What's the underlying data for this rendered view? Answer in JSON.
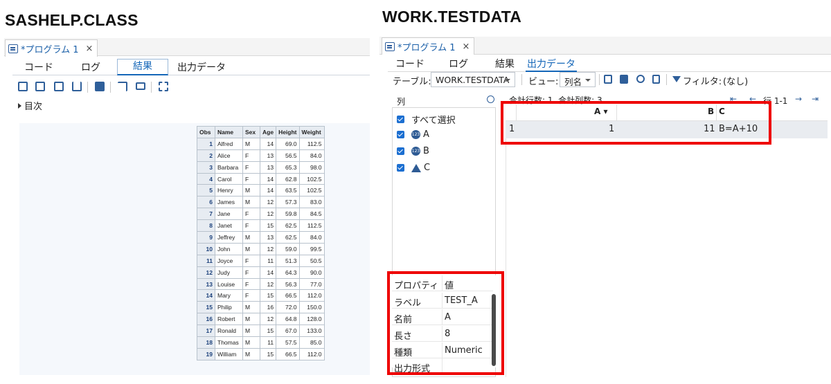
{
  "left": {
    "heading": "SASHELP.CLASS",
    "tab_title": "*プログラム 1",
    "tab_close": "×",
    "subtabs": [
      "コード",
      "ログ",
      "結果",
      "出力データ"
    ],
    "toc_label": "目次",
    "table": {
      "columns": [
        "Obs",
        "Name",
        "Sex",
        "Age",
        "Height",
        "Weight"
      ],
      "rows": [
        [
          "1",
          "Alfred",
          "M",
          "14",
          "69.0",
          "112.5"
        ],
        [
          "2",
          "Alice",
          "F",
          "13",
          "56.5",
          "84.0"
        ],
        [
          "3",
          "Barbara",
          "F",
          "13",
          "65.3",
          "98.0"
        ],
        [
          "4",
          "Carol",
          "F",
          "14",
          "62.8",
          "102.5"
        ],
        [
          "5",
          "Henry",
          "M",
          "14",
          "63.5",
          "102.5"
        ],
        [
          "6",
          "James",
          "M",
          "12",
          "57.3",
          "83.0"
        ],
        [
          "7",
          "Jane",
          "F",
          "12",
          "59.8",
          "84.5"
        ],
        [
          "8",
          "Janet",
          "F",
          "15",
          "62.5",
          "112.5"
        ],
        [
          "9",
          "Jeffrey",
          "M",
          "13",
          "62.5",
          "84.0"
        ],
        [
          "10",
          "John",
          "M",
          "12",
          "59.0",
          "99.5"
        ],
        [
          "11",
          "Joyce",
          "F",
          "11",
          "51.3",
          "50.5"
        ],
        [
          "12",
          "Judy",
          "F",
          "14",
          "64.3",
          "90.0"
        ],
        [
          "13",
          "Louise",
          "F",
          "12",
          "56.3",
          "77.0"
        ],
        [
          "14",
          "Mary",
          "F",
          "15",
          "66.5",
          "112.0"
        ],
        [
          "15",
          "Philip",
          "M",
          "16",
          "72.0",
          "150.0"
        ],
        [
          "16",
          "Robert",
          "M",
          "12",
          "64.8",
          "128.0"
        ],
        [
          "17",
          "Ronald",
          "M",
          "15",
          "67.0",
          "133.0"
        ],
        [
          "18",
          "Thomas",
          "M",
          "11",
          "57.5",
          "85.0"
        ],
        [
          "19",
          "William",
          "M",
          "15",
          "66.5",
          "112.0"
        ]
      ]
    }
  },
  "right": {
    "heading": "WORK.TESTDATA",
    "tab_title": "*プログラム 1",
    "tab_close": "×",
    "subtabs": [
      "コード",
      "ログ",
      "結果",
      "出力データ"
    ],
    "table_label": "テーブル:",
    "table_value": "WORK.TESTDATA",
    "view_label": "ビュー:",
    "view_value": "列名",
    "filter_label": "フィルタ:",
    "filter_value": "(なし)",
    "columns_header": "列",
    "summary": "合計行数: 1  合計列数: 3",
    "row_range": "行 1-1",
    "column_list": [
      "すべて選択",
      "A",
      "B",
      "C"
    ],
    "grid": {
      "headers": [
        "A",
        "B",
        "C"
      ],
      "sort_marker": "▾",
      "row": {
        "num": "1",
        "A": "1",
        "B": "11",
        "C": "B=A+10"
      }
    },
    "properties": {
      "header_key": "プロパティ",
      "header_val": "値",
      "rows": [
        {
          "k": "ラベル",
          "v": "TEST_A"
        },
        {
          "k": "名前",
          "v": "A"
        },
        {
          "k": "長さ",
          "v": "8"
        },
        {
          "k": "種類",
          "v": "Numeric"
        },
        {
          "k": "出力形式",
          "v": ""
        }
      ]
    },
    "highlight_color": "#ee0000"
  }
}
